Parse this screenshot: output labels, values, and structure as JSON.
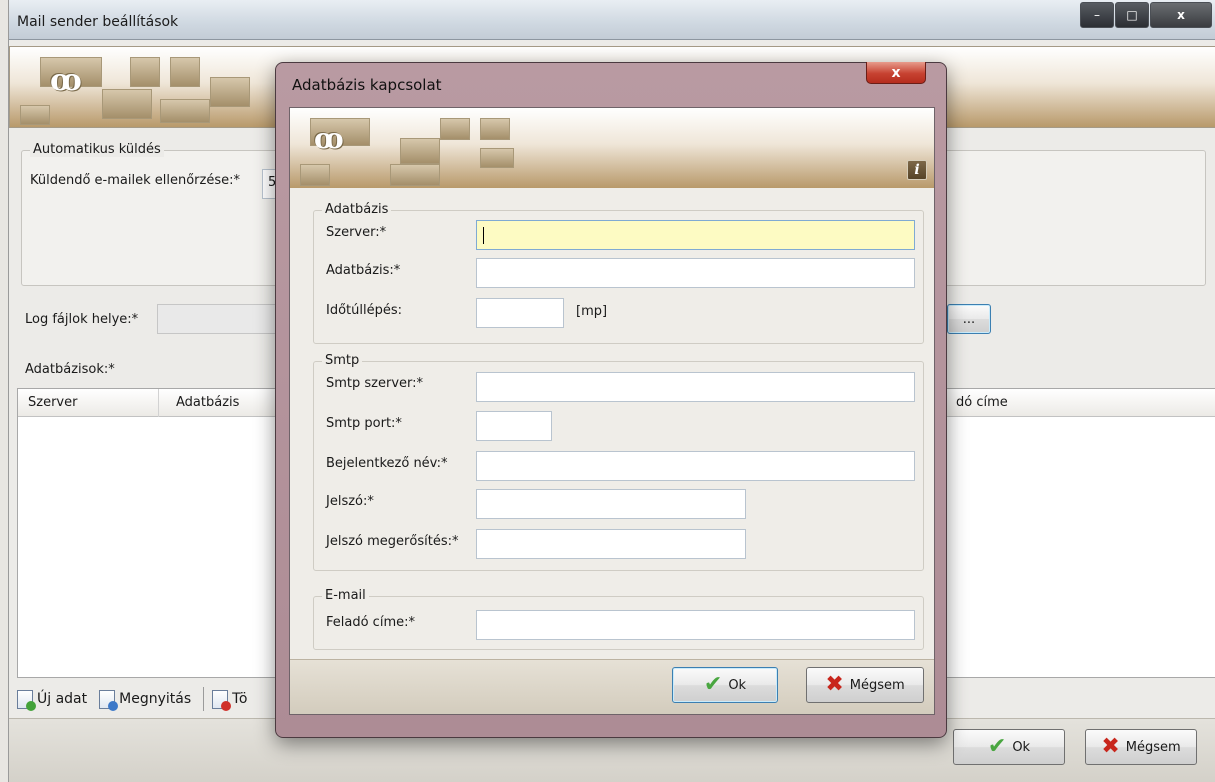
{
  "main": {
    "title": "Mail sender beállítások",
    "window_buttons": {
      "minimize": "–",
      "maximize": "□",
      "close": "x"
    },
    "auto_send": {
      "group_title": "Automatikus küldés",
      "check_label": "Küldendő e-mailek ellenőrzése:*",
      "check_value": "5"
    },
    "log_label": "Log fájlok helye:*",
    "browse_label": "...",
    "databases_label": "Adatbázisok:*",
    "grid": {
      "columns": [
        "Szerver",
        "Adatbázis",
        "dó címe"
      ]
    },
    "toolbar": {
      "new_label": "Új adat",
      "open_label": "Megnyitás",
      "delete_label": "Tö"
    },
    "ok_label": "Ok",
    "cancel_label": "Mégsem"
  },
  "dialog": {
    "title": "Adatbázis kapcsolat",
    "close_glyph": "x",
    "info_glyph": "i",
    "database": {
      "group_title": "Adatbázis",
      "server_label": "Szerver:*",
      "server_value": "",
      "database_label": "Adatbázis:*",
      "database_value": "",
      "timeout_label": "Időtúllépés:",
      "timeout_value": "",
      "timeout_unit": "[mp]"
    },
    "smtp": {
      "group_title": "Smtp",
      "server_label": "Smtp szerver:*",
      "server_value": "",
      "port_label": "Smtp port:*",
      "port_value": "",
      "login_label": "Bejelentkező név:*",
      "login_value": "",
      "password_label": "Jelszó:*",
      "password_value": "",
      "password_confirm_label": "Jelszó megerősítés:*",
      "password_confirm_value": ""
    },
    "email": {
      "group_title": "E-mail",
      "sender_label": "Feladó címe:*",
      "sender_value": ""
    },
    "ok_label": "Ok",
    "cancel_label": "Mégsem"
  },
  "colors": {
    "focus_field": "#fdfbc3",
    "dialog_frame": "#b99aa2",
    "ok_check": "#49a640",
    "cancel_x": "#c8261c"
  }
}
